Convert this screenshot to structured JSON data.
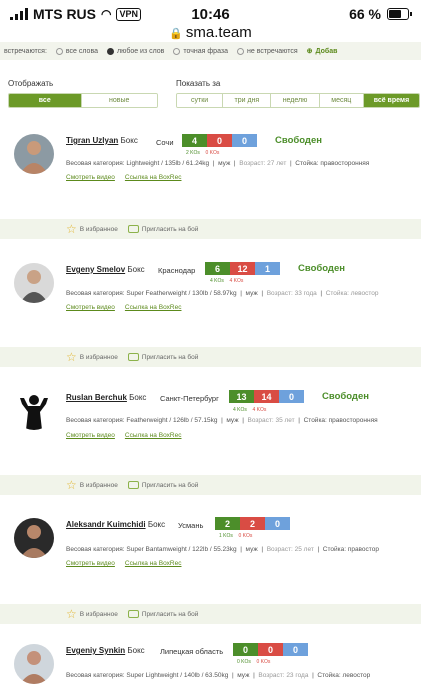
{
  "status_bar": {
    "carrier": "MTS RUS",
    "vpn": "VPN",
    "time": "10:46",
    "battery": "66 %"
  },
  "url": "sma.team",
  "filters": {
    "match_label": "встречаются:",
    "match_options": [
      {
        "label": "все слова",
        "selected": false
      },
      {
        "label": "любое из слов",
        "selected": true
      },
      {
        "label": "точная фраза",
        "selected": false
      },
      {
        "label": "не встречаются",
        "selected": false
      }
    ],
    "extra": "Добав",
    "display_label": "Отображать",
    "display_options": [
      {
        "label": "все",
        "active": true
      },
      {
        "label": "новые",
        "active": false
      }
    ],
    "period_label": "Показать за",
    "period_options": [
      {
        "label": "сутки",
        "active": false
      },
      {
        "label": "три дня",
        "active": false
      },
      {
        "label": "неделю",
        "active": false
      },
      {
        "label": "месяц",
        "active": false
      },
      {
        "label": "всё время",
        "active": true
      }
    ]
  },
  "actions": {
    "favorite": "В избранное",
    "invite": "Пригласить на бой"
  },
  "fighters": [
    {
      "name": "Tigran Uzlyan",
      "sport": "Бокс",
      "city": "Сочи",
      "wins": "4",
      "losses": "0",
      "draws": "0",
      "ko_wins": "2 KOs",
      "ko_losses": "0 KOs",
      "status": "Свободен",
      "info_a": "Весовая категория: Lightweight / 135lb / 61.24kg",
      "sex": "муж",
      "age": "Возраст: 27 лет",
      "stance": "Стойка: правосторонняя",
      "video": "Смотреть видео",
      "boxrec": "Ссылка на BoxRec"
    },
    {
      "name": "Evgeny Smelov",
      "sport": "Бокс",
      "city": "Краснодар",
      "wins": "6",
      "losses": "12",
      "draws": "1",
      "ko_wins": "4 KOs",
      "ko_losses": "4 KOs",
      "status": "Свободен",
      "info_a": "Весовая категория: Super Featherweight / 130lb / 58.97kg",
      "sex": "муж",
      "age": "Возраст: 33 года",
      "stance": "Стойка: левостор",
      "video": "Смотреть видео",
      "boxrec": "Ссылка на BoxRec"
    },
    {
      "name": "Ruslan Berchuk",
      "sport": "Бокс",
      "city": "Санкт-Петербург",
      "wins": "13",
      "losses": "14",
      "draws": "0",
      "ko_wins": "4 KOs",
      "ko_losses": "4 KOs",
      "status": "Свободен",
      "info_a": "Весовая категория: Featherweight / 126lb / 57.15kg",
      "sex": "муж",
      "age": "Возраст: 35 лет",
      "stance": "Стойка: правосторонняя",
      "video": "Смотреть видео",
      "boxrec": "Ссылка на BoxRec"
    },
    {
      "name": "Aleksandr Kuimchidi",
      "sport": "Бокс",
      "city": "Усмань",
      "wins": "2",
      "losses": "2",
      "draws": "0",
      "ko_wins": "1 KOs",
      "ko_losses": "0 KOs",
      "status": "",
      "info_a": "Весовая категория: Super Bantamweight / 122lb / 55.23kg",
      "sex": "муж",
      "age": "Возраст: 25 лет",
      "stance": "Стойка: правостор",
      "video": "Смотреть видео",
      "boxrec": "Ссылка на BoxRec"
    },
    {
      "name": "Evgeniy Synkin",
      "sport": "Бокс",
      "city": "Липецкая область",
      "wins": "0",
      "losses": "0",
      "draws": "0",
      "ko_wins": "0 KOs",
      "ko_losses": "0 KOs",
      "status": "",
      "info_a": "Весовая категория: Super Lightweight / 140lb / 63.50kg",
      "sex": "муж",
      "age": "Возраст: 23 года",
      "stance": "Стойка: левостор",
      "video": "",
      "boxrec": ""
    }
  ]
}
